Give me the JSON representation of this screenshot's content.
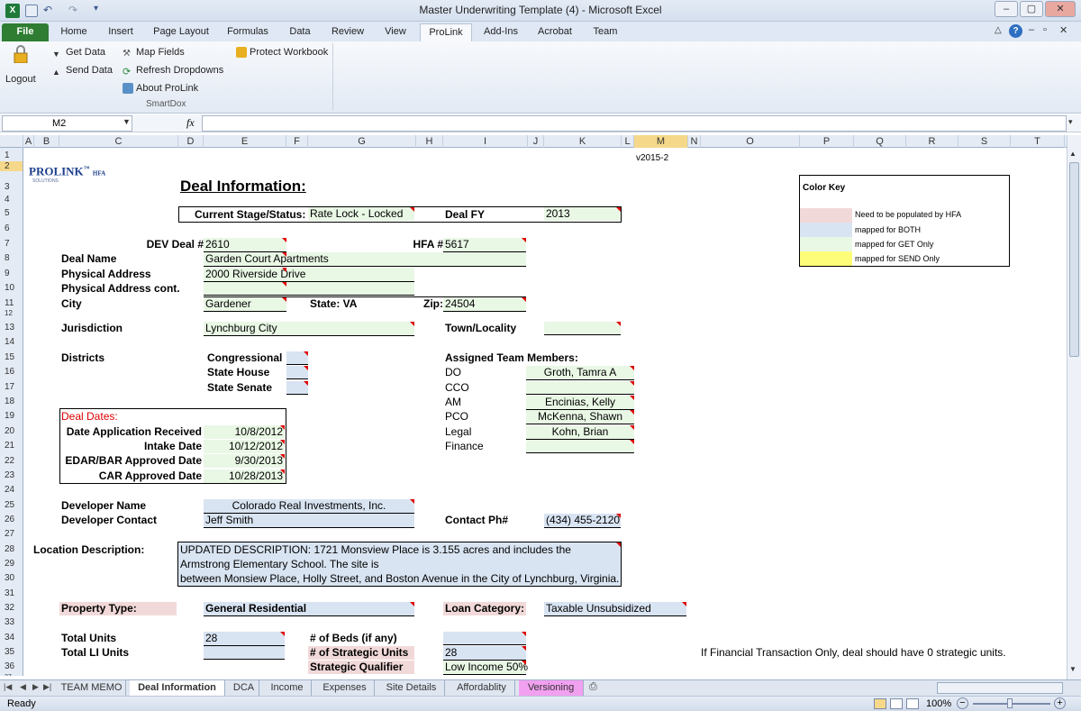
{
  "window": {
    "title": "Master Underwriting Template (4)  -  Microsoft Excel"
  },
  "ribbon_tabs": [
    "File",
    "Home",
    "Insert",
    "Page Layout",
    "Formulas",
    "Data",
    "Review",
    "View",
    "ProLink",
    "Add-Ins",
    "Acrobat",
    "Team"
  ],
  "ribbon": {
    "logout": "Logout",
    "get_data": "Get Data",
    "send_data": "Send Data",
    "map_fields": "Map Fields",
    "refresh_dropdowns": "Refresh Dropdowns",
    "about_prolink": "About ProLink",
    "protect_workbook": "Protect Workbook",
    "group_label": "SmartDox"
  },
  "formula_bar": {
    "name_box": "M2",
    "fx": "fx",
    "formula": ""
  },
  "columns": [
    "A",
    "B",
    "C",
    "D",
    "E",
    "F",
    "G",
    "H",
    "I",
    "J",
    "K",
    "L",
    "M",
    "N",
    "O",
    "P",
    "Q",
    "R",
    "S",
    "T"
  ],
  "rows": [
    "1",
    "2",
    "3",
    "4",
    "5",
    "6",
    "7",
    "8",
    "9",
    "10",
    "11",
    "12",
    "13",
    "14",
    "15",
    "16",
    "17",
    "18",
    "19",
    "20",
    "21",
    "22",
    "23",
    "24",
    "25",
    "26",
    "27",
    "28",
    "29",
    "30",
    "31",
    "32",
    "33",
    "34",
    "35",
    "36",
    "37"
  ],
  "sheet": {
    "logo_main": "PROLINK",
    "logo_tm": "™",
    "logo_sub": "HFA",
    "logo_solutions": "SOLUTIONS",
    "version": "v2015-2",
    "title": "Deal Information:",
    "current_stage_label": "Current Stage/Status:",
    "current_stage_value": "Rate Lock - Locked",
    "deal_fy_label": "Deal FY",
    "deal_fy_value": "2013",
    "dev_deal_label": "DEV Deal #",
    "dev_deal_value": "2610",
    "hfa_label": "HFA #",
    "hfa_value": "5617",
    "deal_name_label": "Deal Name",
    "deal_name_value": "Garden Court Apartments",
    "phys_addr_label": "Physical Address",
    "phys_addr_value": "2000 Riverside Drive",
    "phys_addr2_label": "Physical Address cont.",
    "city_label": "City",
    "city_value": "Gardener",
    "state_label": "State: VA",
    "zip_label": "Zip:",
    "zip_value": "24504",
    "jurisdiction_label": "Jurisdiction",
    "jurisdiction_value": "Lynchburg City",
    "town_label": "Town/Locality",
    "districts_label": "Districts",
    "congressional_label": "Congressional",
    "state_house_label": "State House",
    "state_senate_label": "State Senate",
    "team_label": "Assigned Team Members:",
    "do_label": "DO",
    "do_value": "Groth, Tamra A",
    "cco_label": "CCO",
    "am_label": "AM",
    "am_value": "Encinias, Kelly",
    "pco_label": "PCO",
    "pco_value": "McKenna, Shawn",
    "legal_label": "Legal",
    "legal_value": "Kohn, Brian",
    "finance_label": "Finance",
    "deal_dates_label": "Deal Dates:",
    "date_app_label": "Date Application Received",
    "date_app_value": "10/8/2012",
    "intake_label": "Intake Date",
    "intake_value": "10/12/2012",
    "edar_label": "EDAR/BAR Approved Date",
    "edar_value": "9/30/2013",
    "car_label": "CAR Approved Date",
    "car_value": "10/28/2013",
    "dev_name_label": "Developer Name",
    "dev_name_value": "Colorado Real Investments, Inc.",
    "dev_contact_label": "Developer Contact",
    "dev_contact_value": "Jeff Smith",
    "contact_ph_label": "Contact Ph#",
    "contact_ph_value": "(434) 455-2120",
    "loc_desc_label": "Location Description:",
    "loc_desc_line1": "UPDATED DESCRIPTION:  1721 Monsview Place is 3.155 acres and includes the",
    "loc_desc_line2": "Armstrong Elementary School. The site is",
    "loc_desc_line3": "between Monsiew Place, Holly Street, and Boston Avenue in the City of Lynchburg, Virginia.",
    "prop_type_label": "Property Type:",
    "prop_type_value": "General Residential",
    "loan_cat_label": "Loan Category:",
    "loan_cat_value": "Taxable Unsubsidized",
    "total_units_label": "Total Units",
    "total_units_value": "28",
    "beds_label": "# of Beds (if any)",
    "total_li_label": "Total LI Units",
    "strategic_units_label": "# of Strategic Units",
    "strategic_units_value": "28",
    "strategic_note": "If Financial Transaction Only, deal should have 0 strategic units.",
    "strategic_qual_label": "Strategic Qualifier",
    "strategic_qual_value": "Low Income 50%",
    "color_key": {
      "title": "Color Key",
      "items": [
        {
          "color": "#f2d9d9",
          "label": "Need to be populated by HFA"
        },
        {
          "color": "#d9e4f2",
          "label": "mapped for BOTH"
        },
        {
          "color": "#e9f7e5",
          "label": "mapped for GET Only"
        },
        {
          "color": "#fdfd7a",
          "label": "mapped for SEND Only"
        }
      ]
    }
  },
  "sheet_tabs": [
    "TEAM MEMO",
    "Deal Information",
    "DCA",
    "Income",
    "Expenses",
    "Site Details",
    "Affordablity",
    "Versioning"
  ],
  "status": {
    "ready": "Ready",
    "zoom": "100%"
  }
}
